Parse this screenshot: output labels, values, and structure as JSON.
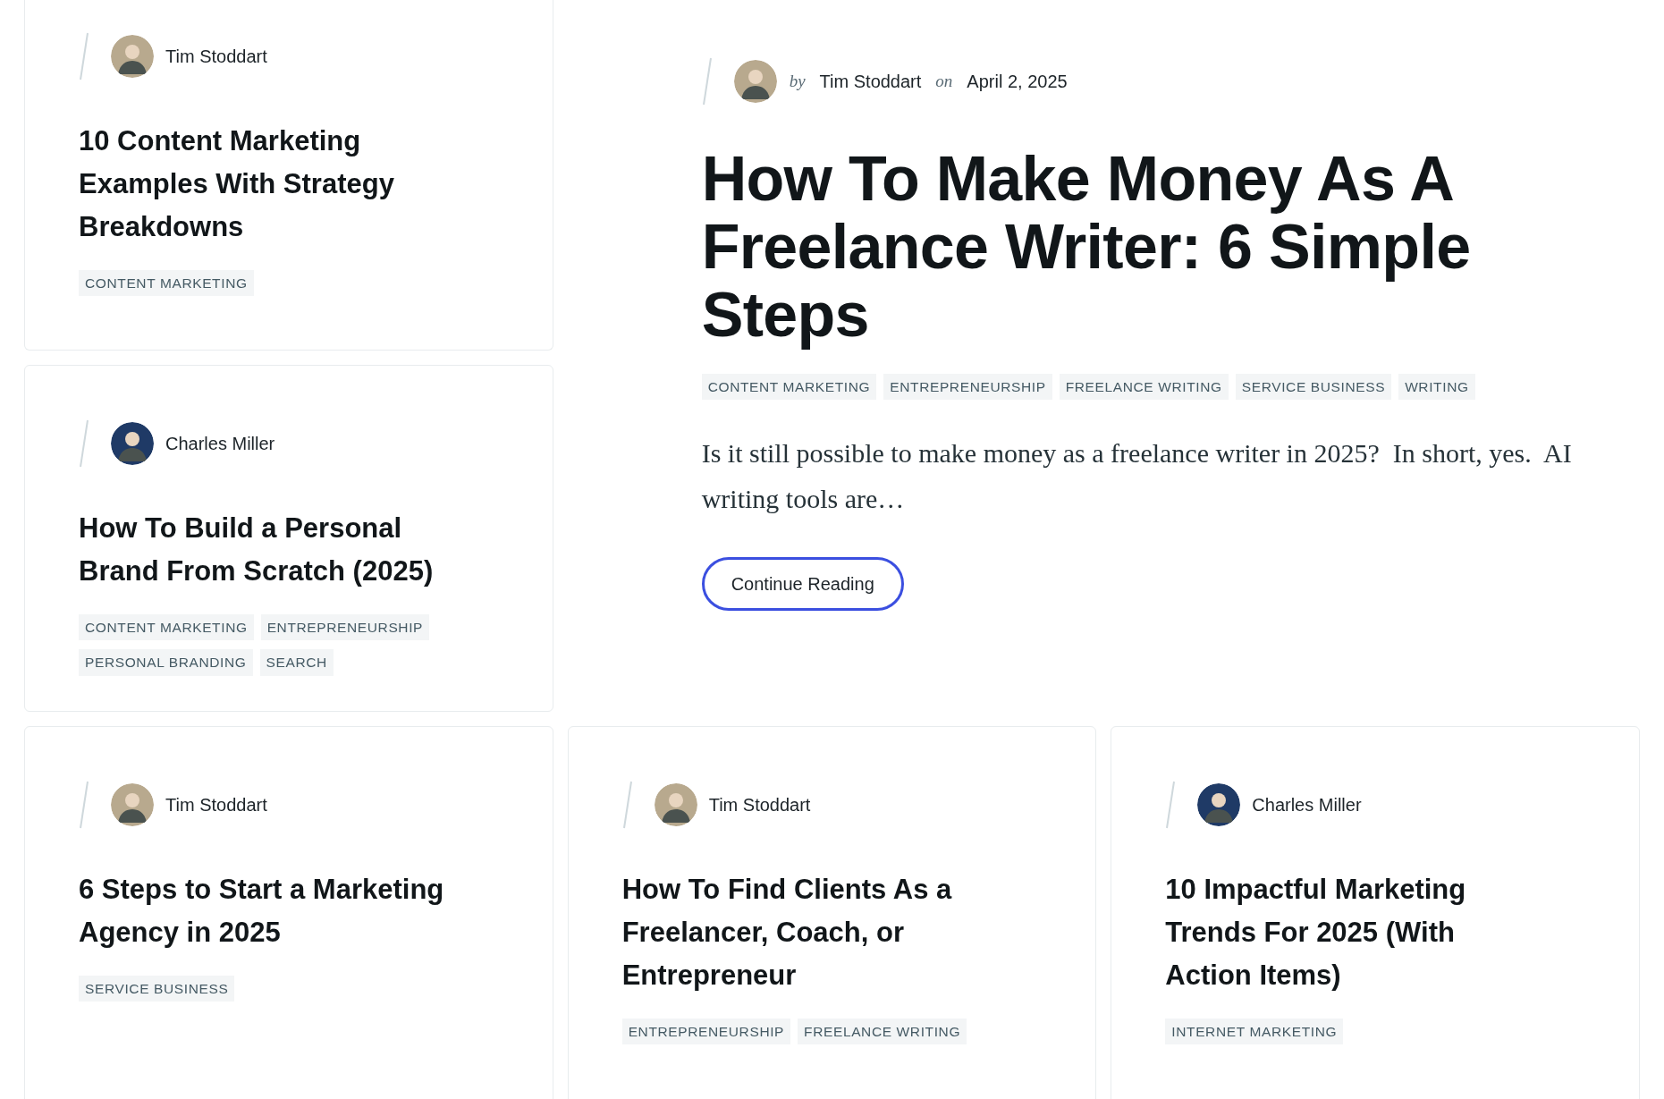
{
  "side_cards": [
    {
      "author": {
        "name": "Tim Stoddart",
        "color": "#b8a98e"
      },
      "title": "10 Content Marketing Examples With Strategy Breakdowns",
      "tags": [
        "CONTENT MARKETING"
      ]
    },
    {
      "author": {
        "name": "Charles Miller",
        "color": "#1f3a66"
      },
      "title": "How To Build a Personal Brand From Scratch (2025)",
      "tags": [
        "CONTENT MARKETING",
        "ENTREPRENEURSHIP",
        "PERSONAL BRANDING",
        "SEARCH"
      ]
    }
  ],
  "featured": {
    "by": "by",
    "author": {
      "name": "Tim Stoddart",
      "color": "#b8a98e"
    },
    "on": "on",
    "date": "April 2, 2025",
    "title": "How To Make Money As A Freelance Writer: 6 Simple Steps",
    "tags": [
      "CONTENT MARKETING",
      "ENTREPRENEURSHIP",
      "FREELANCE WRITING",
      "SERVICE BUSINESS",
      "WRITING"
    ],
    "excerpt": "Is it still possible to make money as a freelance writer in 2025?  In short, yes.  AI writing tools are…",
    "button": "Continue Reading"
  },
  "bottom_cards": [
    {
      "author": {
        "name": "Tim Stoddart",
        "color": "#b8a98e"
      },
      "title": "6 Steps to Start a Marketing Agency in 2025",
      "tags": [
        "SERVICE BUSINESS"
      ]
    },
    {
      "author": {
        "name": "Tim Stoddart",
        "color": "#b8a98e"
      },
      "title": "How To Find Clients As a Freelancer, Coach, or Entrepreneur",
      "tags": [
        "ENTREPRENEURSHIP",
        "FREELANCE WRITING"
      ]
    },
    {
      "author": {
        "name": "Charles Miller",
        "color": "#1f3a66"
      },
      "title": "10 Impactful Marketing Trends For 2025 (With Action Items)",
      "tags": [
        "INTERNET MARKETING"
      ]
    }
  ]
}
